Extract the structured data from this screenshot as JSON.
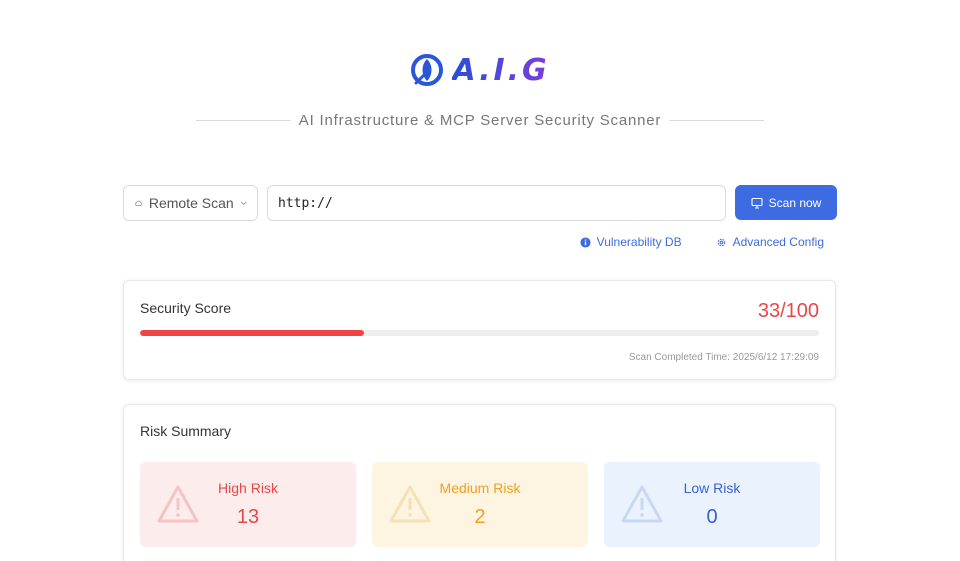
{
  "brand": {
    "name": "A.I.G",
    "logo_icon": "aig-logo-icon"
  },
  "subtitle": "AI Infrastructure & MCP Server Security Scanner",
  "scan_bar": {
    "mode_label": "Remote Scan",
    "mode_icon": "cloud-icon",
    "url_value": "http://",
    "scan_button_label": "Scan now",
    "scan_button_icon": "monitor-icon"
  },
  "links": {
    "vuln_db": "Vulnerability DB",
    "advanced_config": "Advanced Config"
  },
  "security_score": {
    "title": "Security Score",
    "score_text": "33/100",
    "score_fraction": 0.33,
    "completed_time": "Scan Completed Time: 2025/6/12 17:29:09"
  },
  "risk_summary": {
    "title": "Risk Summary",
    "items": [
      {
        "label": "High Risk",
        "count": "13"
      },
      {
        "label": "Medium Risk",
        "count": "2"
      },
      {
        "label": "Low Risk",
        "count": "0"
      }
    ]
  },
  "colors": {
    "accent": "#3c6be2",
    "high": "#e84749",
    "medium": "#f0a020",
    "low": "#3c5fd0"
  }
}
